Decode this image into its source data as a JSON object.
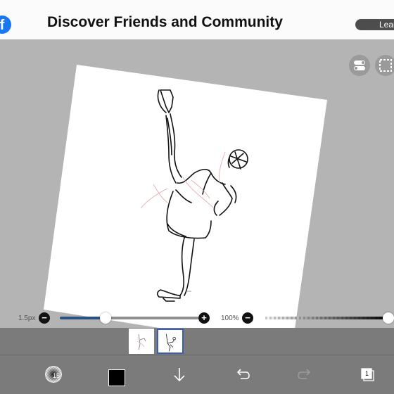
{
  "ad": {
    "icon": "facebook-logo-icon",
    "title": "Discover Friends and Community",
    "button_label": "Learn More"
  },
  "canvas": {
    "top_right_buttons": [
      "toggle-icon",
      "selection-icon"
    ]
  },
  "brush_size": {
    "label": "1.5px",
    "minus": "−",
    "plus": "+",
    "value_fraction": 0.4
  },
  "opacity": {
    "label": "100%",
    "minus": "−",
    "value_fraction": 1.0
  },
  "layers": {
    "thumbnails": 2,
    "selected_index": 1
  },
  "toolbar": {
    "brush_badge": "15",
    "color": "#000000",
    "layers_count": "1",
    "icons": [
      "brush-icon",
      "color-swatch",
      "download-arrow-icon",
      "undo-icon",
      "redo-icon",
      "layers-icon"
    ]
  },
  "colors": {
    "accent": "#3a5db8",
    "facebook_blue": "#1877f2",
    "brush_track": "#2c5181"
  }
}
